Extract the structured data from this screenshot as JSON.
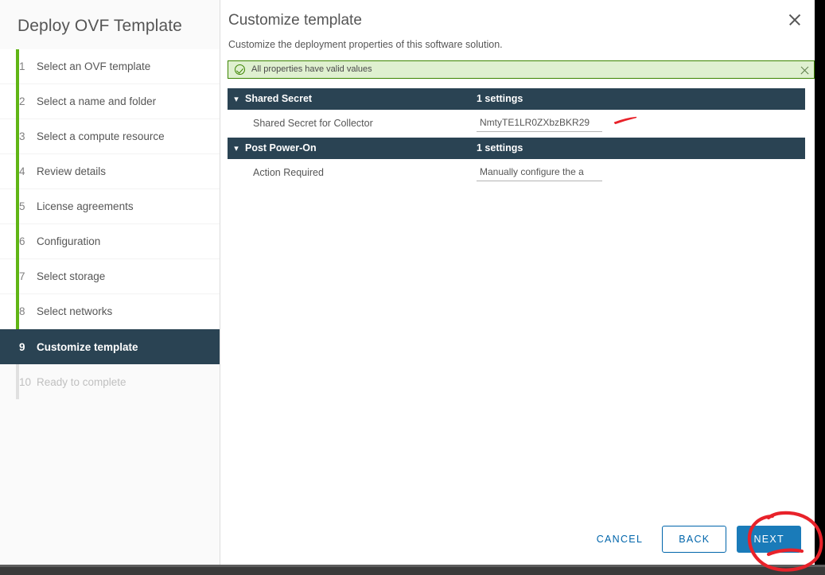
{
  "wizard": {
    "title": "Deploy OVF Template",
    "steps": [
      {
        "num": "1",
        "label": "Select an OVF template",
        "state": "done"
      },
      {
        "num": "2",
        "label": "Select a name and folder",
        "state": "done"
      },
      {
        "num": "3",
        "label": "Select a compute resource",
        "state": "done"
      },
      {
        "num": "4",
        "label": "Review details",
        "state": "done"
      },
      {
        "num": "5",
        "label": "License agreements",
        "state": "done"
      },
      {
        "num": "6",
        "label": "Configuration",
        "state": "done"
      },
      {
        "num": "7",
        "label": "Select storage",
        "state": "done"
      },
      {
        "num": "8",
        "label": "Select networks",
        "state": "done"
      },
      {
        "num": "9",
        "label": "Customize template",
        "state": "active"
      },
      {
        "num": "10",
        "label": "Ready to complete",
        "state": "disabled"
      }
    ]
  },
  "page": {
    "title": "Customize template",
    "subtitle": "Customize the deployment properties of this software solution.",
    "close_icon": "close-icon"
  },
  "alert": {
    "icon": "check-circle-icon",
    "message": "All properties have valid values",
    "close_icon": "close-icon",
    "border_color": "#3c8500",
    "background_color": "#dff0d0"
  },
  "property_groups": [
    {
      "name": "Shared Secret",
      "count_label": "1 settings",
      "chevron": "chevron-down-icon",
      "properties": [
        {
          "label": "Shared Secret for Collector",
          "value": "NmtyTE1LR0ZXbzBKR29",
          "placeholder": ""
        }
      ]
    },
    {
      "name": "Post Power-On",
      "count_label": "1 settings",
      "chevron": "chevron-down-icon",
      "properties": [
        {
          "label": "Action Required",
          "value": "Manually configure the a",
          "placeholder": ""
        }
      ]
    }
  ],
  "footer": {
    "cancel_label": "CANCEL",
    "back_label": "BACK",
    "next_label": "NEXT"
  },
  "annotations": {
    "color": "#e8222a",
    "dash_near_secret": "red-dash-mark",
    "circle_around_next": "red-circle-highlight"
  },
  "theme": {
    "header_dark": "#2a4353",
    "progress_green": "#60b515",
    "primary_blue": "#1a7bb9",
    "link_blue": "#0065ab"
  }
}
